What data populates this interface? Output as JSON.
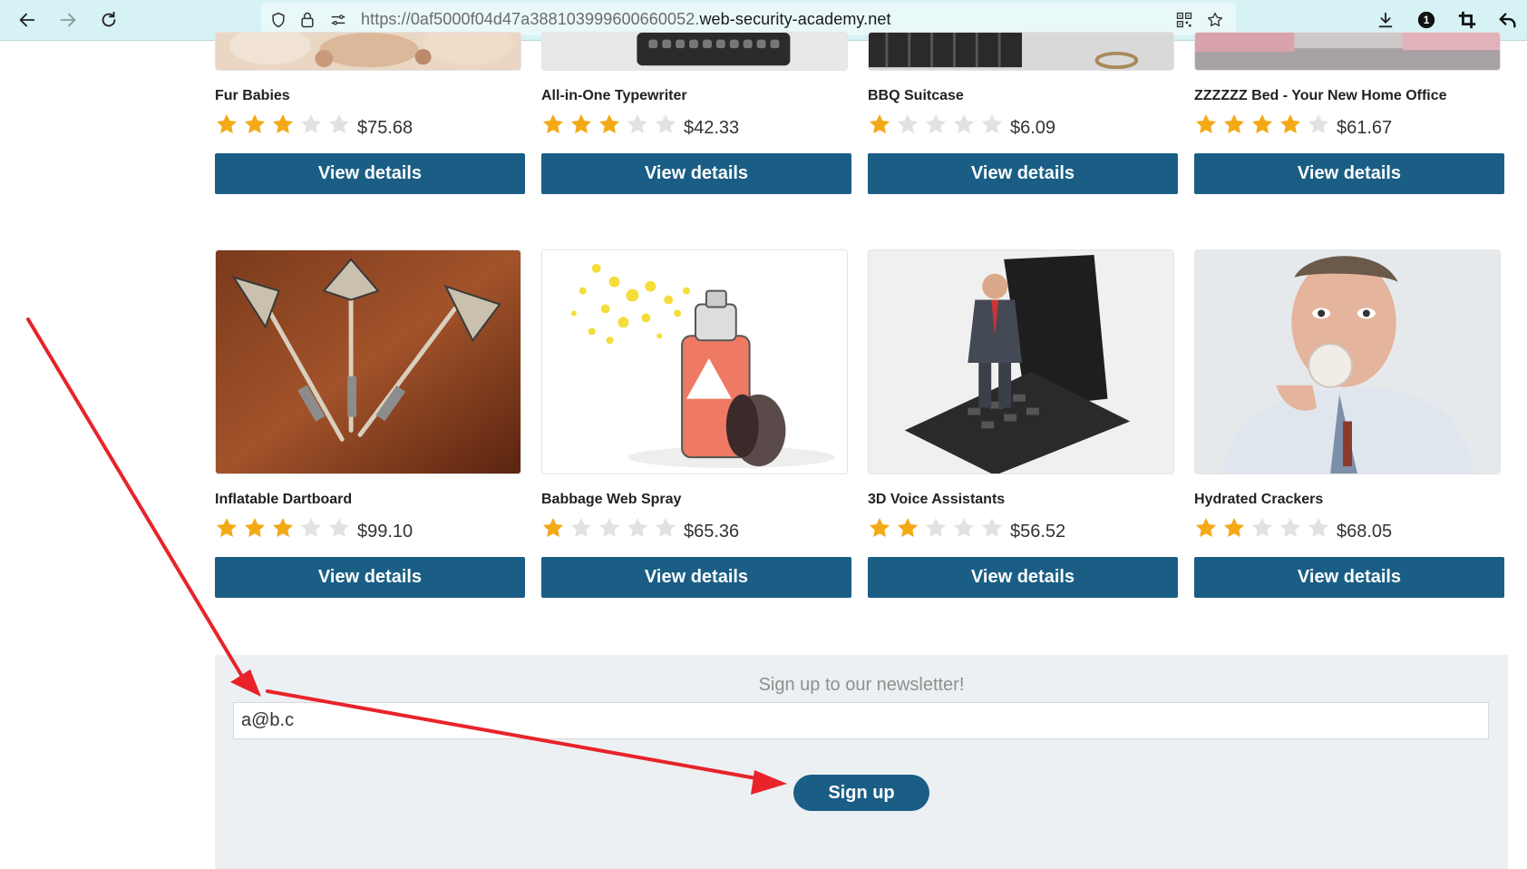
{
  "browser": {
    "url_prefix": "https://0af5000f04d47a388103999600660052.",
    "url_host": "web-security-academy.net",
    "icons": [
      "back-icon",
      "forward-icon",
      "reload-icon",
      "shield-icon",
      "lock-icon",
      "site-settings-icon",
      "qr-code-icon",
      "bookmark-star-icon",
      "download-icon",
      "extension-badge-icon",
      "crop-icon",
      "undo-icon"
    ],
    "badge_count": "1"
  },
  "products": [
    {
      "name": "Fur Babies",
      "rating": 3,
      "price": "$75.68",
      "button": "View details"
    },
    {
      "name": "All-in-One Typewriter",
      "rating": 3,
      "price": "$42.33",
      "button": "View details"
    },
    {
      "name": "BBQ Suitcase",
      "rating": 1,
      "price": "$6.09",
      "button": "View details"
    },
    {
      "name": "ZZZZZZ Bed - Your New Home Office",
      "rating": 4,
      "price": "$61.67",
      "button": "View details"
    },
    {
      "name": "Inflatable Dartboard",
      "rating": 3,
      "price": "$99.10",
      "button": "View details"
    },
    {
      "name": "Babbage Web Spray",
      "rating": 1,
      "price": "$65.36",
      "button": "View details"
    },
    {
      "name": "3D Voice Assistants",
      "rating": 2,
      "price": "$56.52",
      "button": "View details"
    },
    {
      "name": "Hydrated Crackers",
      "rating": 2,
      "price": "$68.05",
      "button": "View details"
    }
  ],
  "newsletter": {
    "heading": "Sign up to our newsletter!",
    "email_value": "a@b.c",
    "button": "Sign up"
  },
  "colors": {
    "button": "#1a5e85",
    "star_filled": "#f4a916",
    "star_empty": "#e2e2e2",
    "annotation_arrow": "#e8232a"
  }
}
